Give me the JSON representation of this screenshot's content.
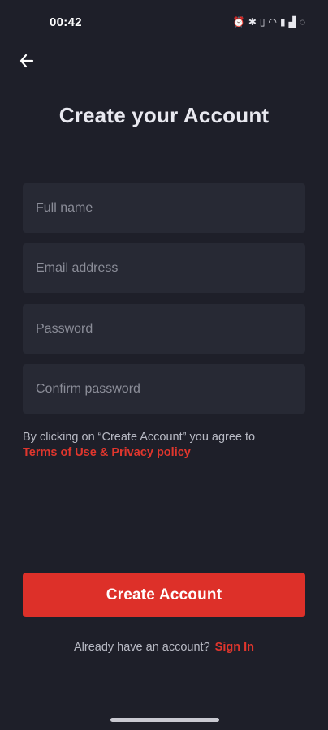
{
  "status_bar": {
    "time": "00:42",
    "icons": [
      "alarm-icon",
      "bluetooth-icon",
      "vibrate-icon",
      "wifi-icon",
      "battery-saver-icon",
      "signal-icon",
      "loading-icon"
    ]
  },
  "header": {
    "back_icon": "arrow-left-icon",
    "title": "Create your Account"
  },
  "form": {
    "full_name": {
      "placeholder": "Full name",
      "value": ""
    },
    "email": {
      "placeholder": "Email address",
      "value": ""
    },
    "password": {
      "placeholder": "Password",
      "value": ""
    },
    "confirm_password": {
      "placeholder": "Confirm password",
      "value": ""
    }
  },
  "terms": {
    "text": "By clicking on “Create Account” you agree to",
    "link": "Terms of Use & Privacy policy"
  },
  "actions": {
    "create_label": "Create Account",
    "signin_prompt": "Already have an account?",
    "signin_link": "Sign In"
  },
  "colors": {
    "background": "#1e1f29",
    "field": "#272934",
    "accent": "#dd3029",
    "text_muted": "#b8bac4"
  }
}
